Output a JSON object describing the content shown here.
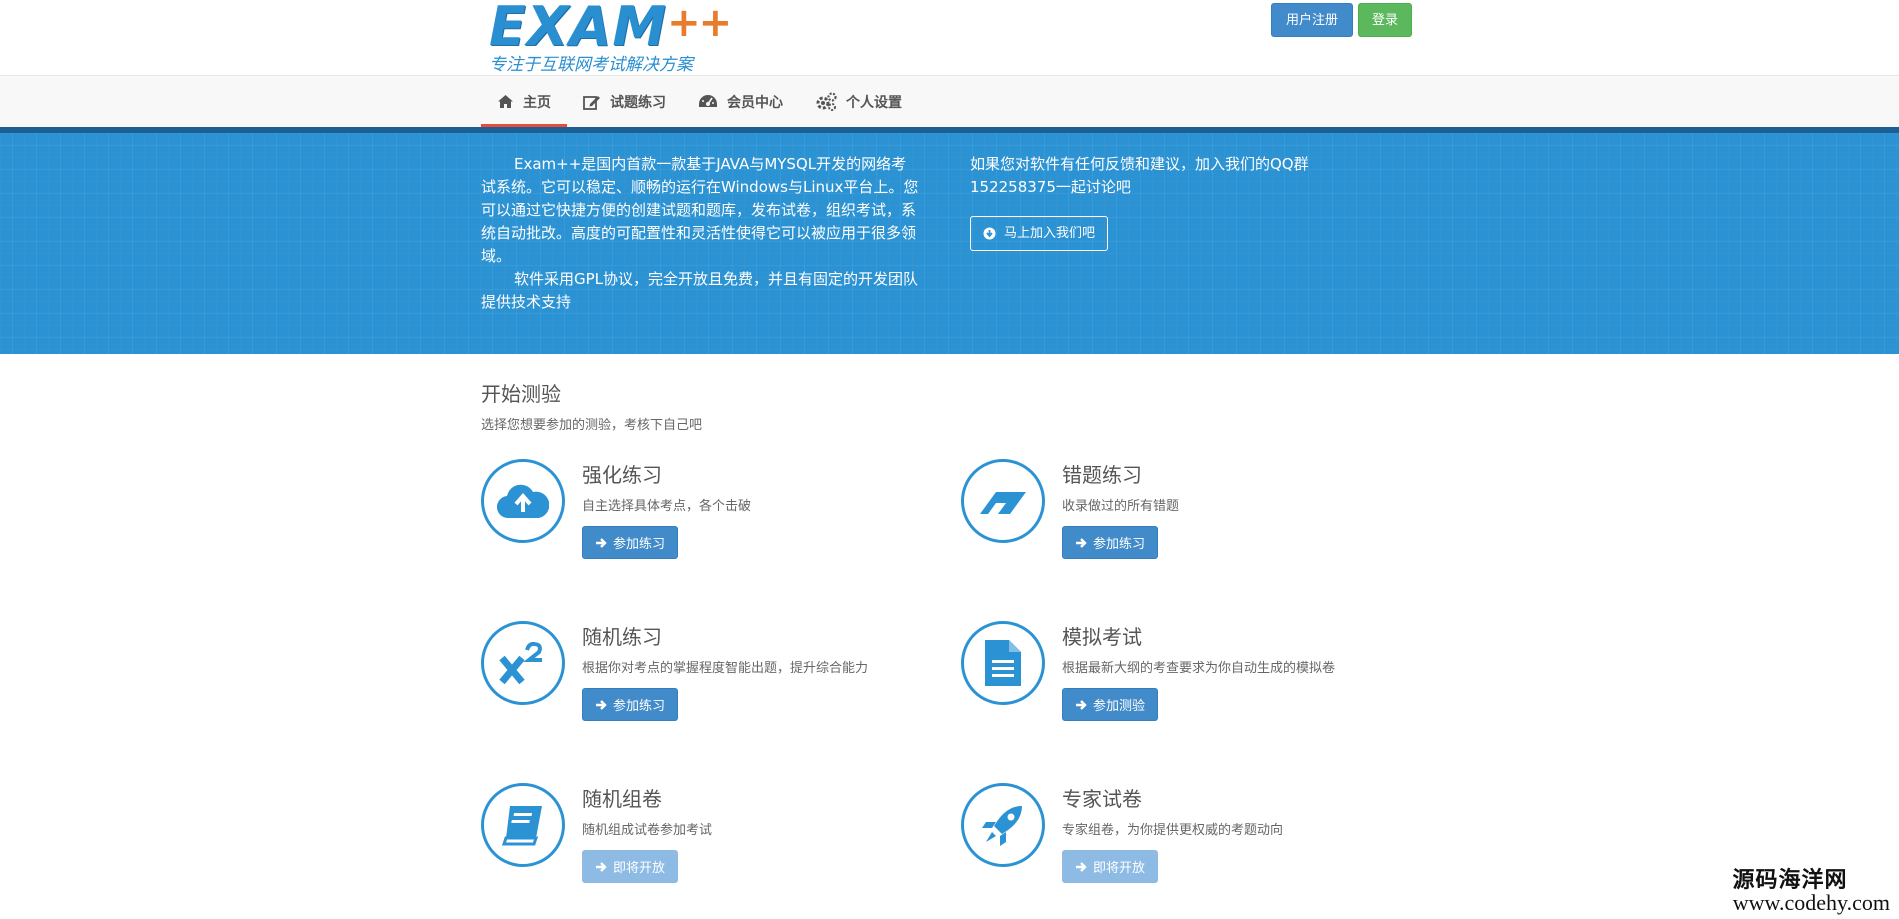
{
  "header": {
    "logo_text": "EXAM",
    "logo_plus": "++",
    "tagline": "专注于互联网考试解决方案",
    "register_label": "用户注册",
    "login_label": "登录"
  },
  "nav": {
    "items": [
      {
        "label": "主页",
        "icon": "home-icon",
        "active": true
      },
      {
        "label": "试题练习",
        "icon": "edit-icon",
        "active": false
      },
      {
        "label": "会员中心",
        "icon": "dashboard-icon",
        "active": false
      },
      {
        "label": "个人设置",
        "icon": "gears-icon",
        "active": false
      }
    ]
  },
  "banner": {
    "para1": "Exam++是国内首款一款基于JAVA与MYSQL开发的网络考试系统。它可以稳定、顺畅的运行在Windows与Linux平台上。您可以通过它快捷方便的创建试题和题库，发布试卷，组织考试，系统自动批改。高度的可配置性和灵活性使得它可以被应用于很多领域。",
    "para2": "软件采用GPL协议，完全开放且免费，并且有固定的开发团队提供技术支持",
    "right_text": "如果您对软件有任何反馈和建议，加入我们的QQ群152258375一起讨论吧",
    "join_label": "马上加入我们吧"
  },
  "section": {
    "title": "开始测验",
    "subtitle": "选择您想要参加的测验，考核下自己吧"
  },
  "cards": [
    {
      "title": "强化练习",
      "desc": "自主选择具体考点，各个击破",
      "button": "参加练习",
      "icon": "cloud-upload-icon",
      "enabled": true
    },
    {
      "title": "错题练习",
      "desc": "收录做过的所有错题",
      "button": "参加练习",
      "icon": "eraser-icon",
      "enabled": true
    },
    {
      "title": "随机练习",
      "desc": "根据你对考点的掌握程度智能出题，提升综合能力",
      "button": "参加练习",
      "icon": "superscript-icon",
      "enabled": true
    },
    {
      "title": "模拟考试",
      "desc": "根据最新大纲的考查要求为你自动生成的模拟卷",
      "button": "参加测验",
      "icon": "document-icon",
      "enabled": true
    },
    {
      "title": "随机组卷",
      "desc": "随机组成试卷参加考试",
      "button": "即将开放",
      "icon": "book-icon",
      "enabled": false
    },
    {
      "title": "专家试卷",
      "desc": "专家组卷，为你提供更权威的考题动向",
      "button": "即将开放",
      "icon": "rocket-icon",
      "enabled": false
    }
  ],
  "watermark": {
    "cn": "源码海洋网",
    "url": "www.codehy.com"
  },
  "colors": {
    "primary": "#428bca",
    "success": "#5cb85c",
    "banner": "#2b93d4",
    "nav_active": "#e74c3c"
  }
}
